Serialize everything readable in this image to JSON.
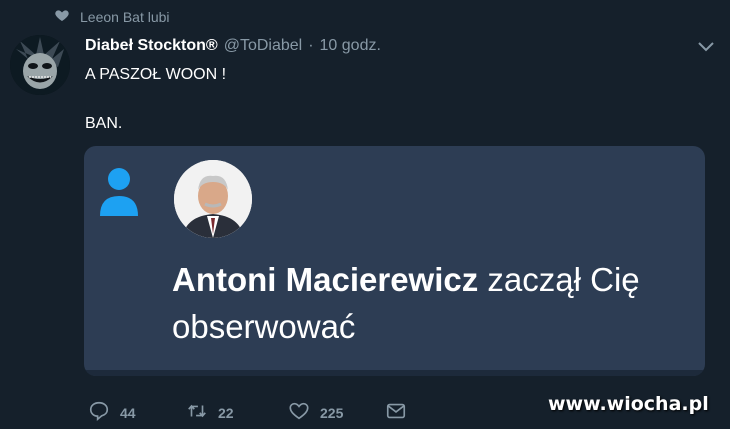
{
  "social_context": {
    "text": "Leeon Bat lubi",
    "icon": "heart-icon"
  },
  "tweet": {
    "author_name": "Diabeł Stockton®",
    "handle": "@ToDiabel",
    "separator": "·",
    "time": "10 godz.",
    "line1": "A PASZOŁ WOON !",
    "line2": "BAN."
  },
  "card": {
    "name": "Antoni Macierewicz",
    "action_text": "zaczął Cię obserwować",
    "icon": "person-icon",
    "accent": "#1da1f2"
  },
  "actions": {
    "replies": "44",
    "retweets": "22",
    "likes": "225"
  },
  "watermark": "www.wiocha.pl",
  "colors": {
    "background": "#15202b",
    "card": "#2d3d54",
    "muted": "#8899a6"
  }
}
